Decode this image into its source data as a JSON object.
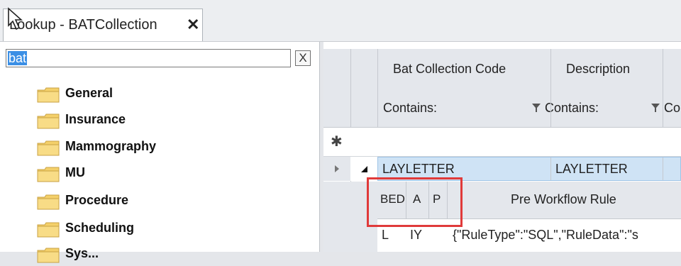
{
  "tab": {
    "title": "Lookup - BATCollection",
    "close_label": "✕"
  },
  "search": {
    "value": "bat",
    "clear_label": "X"
  },
  "tree": {
    "items": [
      {
        "label": "General"
      },
      {
        "label": "Insurance"
      },
      {
        "label": "Mammography"
      },
      {
        "label": "MU"
      },
      {
        "label": "Procedure"
      },
      {
        "label": "Scheduling"
      },
      {
        "label": "Sys..."
      }
    ]
  },
  "grid": {
    "columns": [
      {
        "label": "Bat Collection Code",
        "filter": "Contains:"
      },
      {
        "label": "Description",
        "filter": "Contains:"
      },
      {
        "label": "",
        "filter": "Co"
      }
    ],
    "new_row_symbol": "✱",
    "row": {
      "code": "LAYLETTER",
      "description": "LAYLETTER"
    },
    "detail": {
      "columns": [
        "BED",
        "A",
        "P"
      ],
      "rule_header": "Pre Workflow Rule",
      "row": {
        "c1": "L",
        "c2": "IY",
        "rule": "{\"RuleType\":\"SQL\",\"RuleData\":\"s"
      }
    }
  },
  "colors": {
    "selection": "#3b8fe5",
    "row_highlight": "#cfe3f5",
    "annotation": "#e03a3a"
  }
}
